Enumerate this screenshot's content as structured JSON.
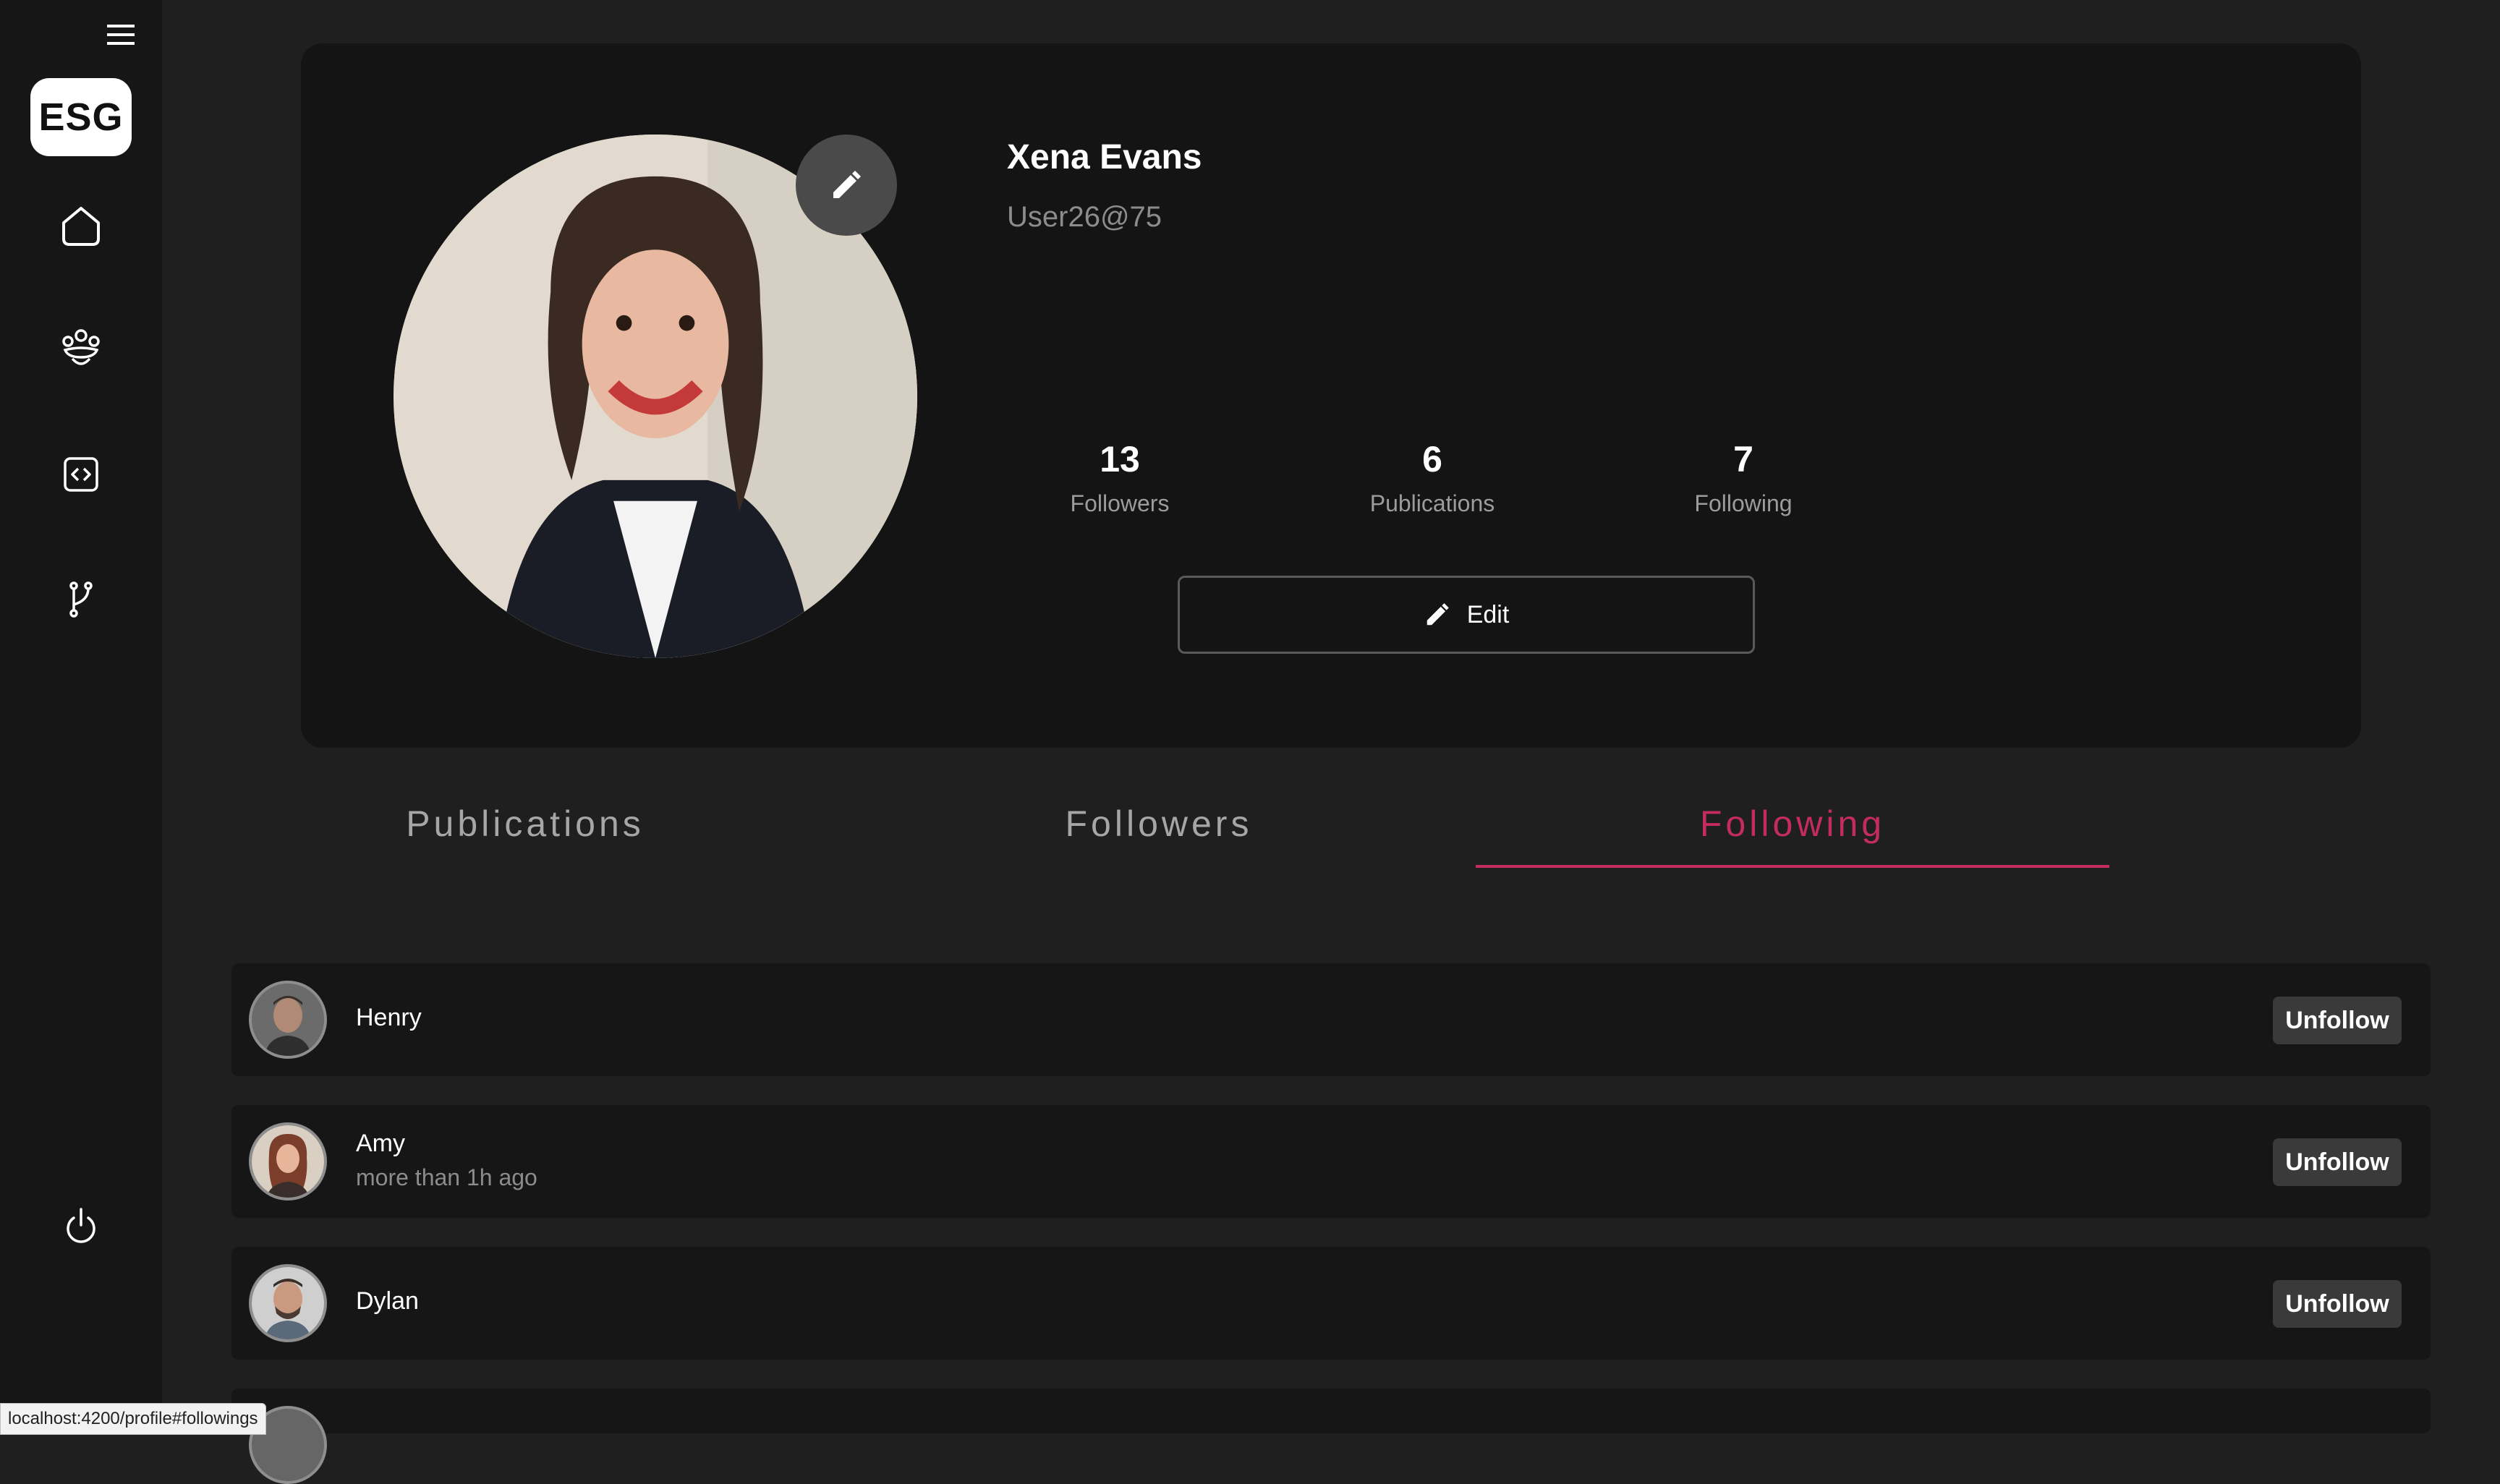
{
  "sidebar": {
    "logo": "ESG",
    "icons": [
      "menu-icon",
      "home-icon",
      "community-icon",
      "code-icon",
      "branch-icon",
      "power-icon"
    ]
  },
  "profile": {
    "name": "Xena Evans",
    "handle": "User26@75",
    "stats": [
      {
        "value": "13",
        "label": "Followers"
      },
      {
        "value": "6",
        "label": "Publications"
      },
      {
        "value": "7",
        "label": "Following"
      }
    ],
    "edit_label": "Edit"
  },
  "tabs": [
    {
      "label": "Publications",
      "active": false
    },
    {
      "label": "Followers",
      "active": false
    },
    {
      "label": "Following",
      "active": true
    }
  ],
  "following": [
    {
      "name": "Henry",
      "subtitle": "",
      "button": "Unfollow"
    },
    {
      "name": "Amy",
      "subtitle": "more than 1h ago",
      "button": "Unfollow"
    },
    {
      "name": "Dylan",
      "subtitle": "",
      "button": "Unfollow"
    }
  ],
  "status_bar": {
    "url": "localhost:4200/profile#followings"
  },
  "colors": {
    "accent": "#c42c5d",
    "background": "#1f1f1f",
    "card": "#141414",
    "sidebar": "#161616"
  }
}
